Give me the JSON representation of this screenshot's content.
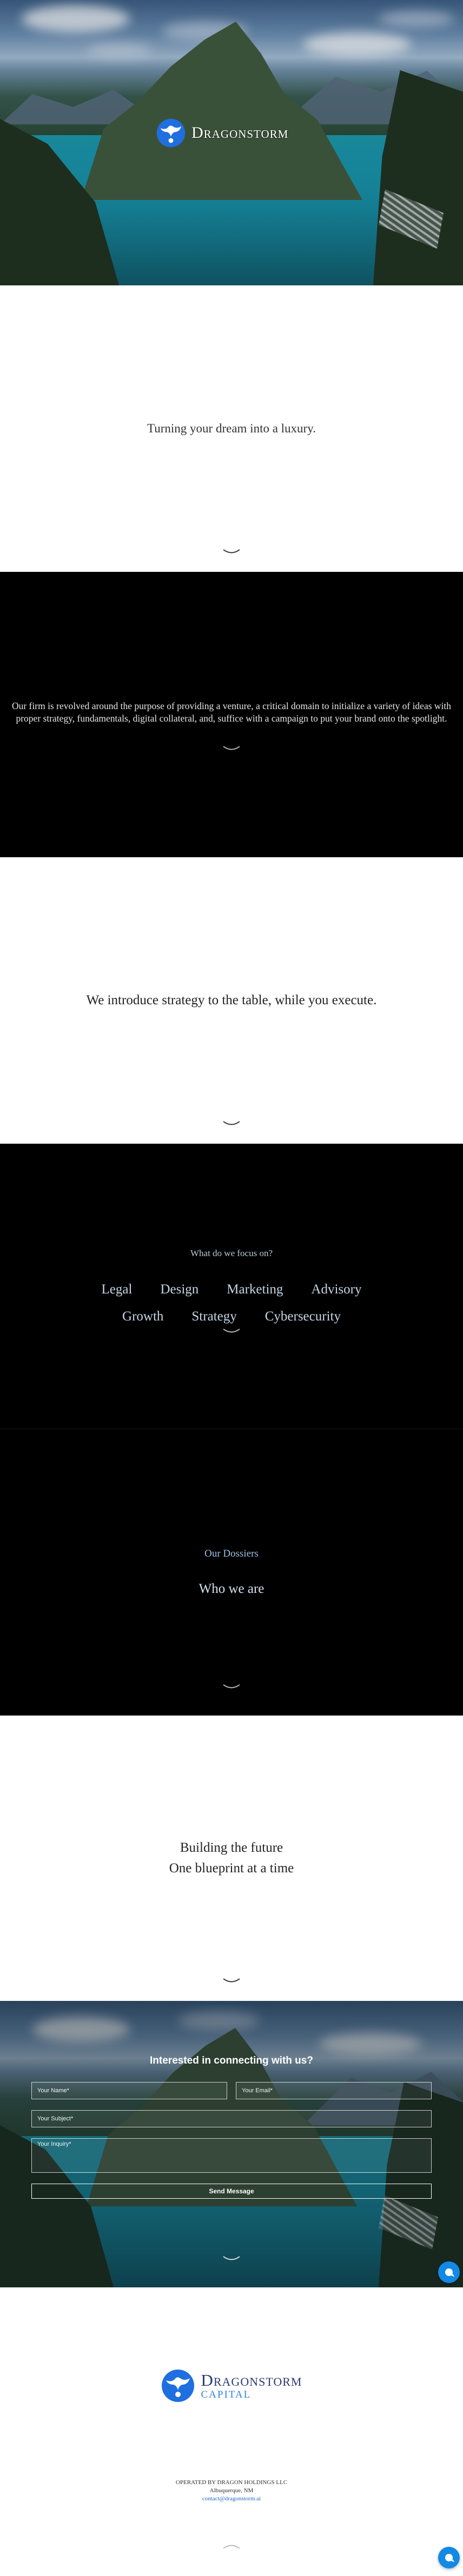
{
  "brand": {
    "name": "Dragonstorm",
    "sub": "CAPITAL"
  },
  "sections": {
    "luxury": {
      "headline": "Turning your dream into a luxury."
    },
    "about": {
      "text": "Our firm is revolved around the purpose of providing a venture, a critical domain to initialize a variety of ideas with proper strategy, fundamentals, digital collateral, and, suffice with a campaign to put your brand onto the spotlight."
    },
    "strategy": {
      "headline": "We introduce strategy to the table, while you execute."
    },
    "focus": {
      "question": "What do we focus on?",
      "items": [
        "Legal",
        "Design",
        "Marketing",
        "Advisory",
        "Growth",
        "Strategy",
        "Cybersecurity"
      ]
    },
    "dossiers": {
      "kicker": "Our Dossiers",
      "headline": "Who we are"
    },
    "future": {
      "line1": "Building the future",
      "line2": "One blueprint at a time"
    }
  },
  "contact": {
    "title": "Interested in connecting with us?",
    "name_placeholder": "Your Name*",
    "email_placeholder": "Your Email*",
    "subject_placeholder": "Your Subject*",
    "inquiry_placeholder": "Your Inquiry*",
    "send_label": "Send Message"
  },
  "footer": {
    "operated_by": "OPERATED BY DRAGON HOLDINGS LLC",
    "location": "Albuquerque, NM",
    "email": "contact@dragonstorm.ai"
  },
  "colors": {
    "accent": "#1189e5",
    "brand_navy": "#2c3a6e",
    "brand_blue": "#2f7fe0",
    "dark_bg": "#000000"
  },
  "icons": {
    "scroll": "chevron-down-icon",
    "chat": "chat-icon",
    "logo": "dragon-logo-icon"
  }
}
